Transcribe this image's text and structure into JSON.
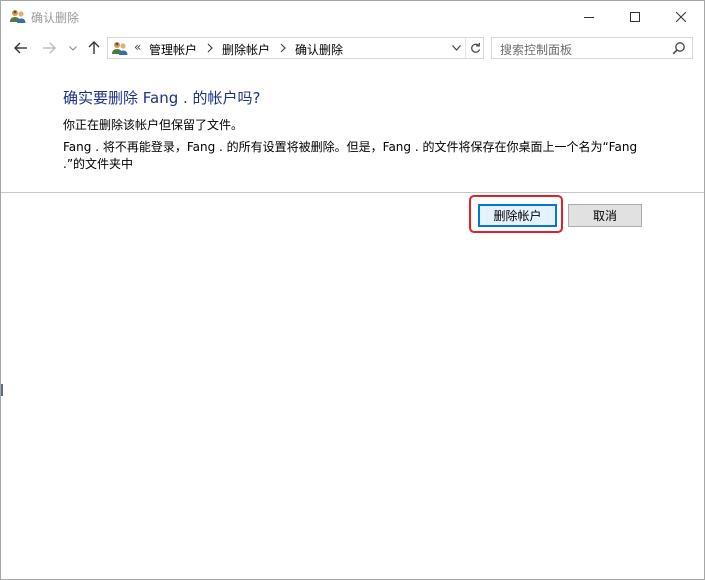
{
  "window": {
    "title": "确认删除"
  },
  "address": {
    "overflow": "«",
    "crumbs": [
      "管理帐户",
      "删除帐户",
      "确认删除"
    ]
  },
  "search": {
    "placeholder": "搜索控制面板"
  },
  "content": {
    "heading": "确实要删除 Fang . 的帐户吗?",
    "line1": "你正在删除该帐户但保留了文件。",
    "line2": "Fang . 将不再能登录，Fang . 的所有设置将被删除。但是，Fang . 的文件将保存在你桌面上一个名为“Fang .”的文件夹中"
  },
  "buttons": {
    "delete": "删除帐户",
    "cancel": "取消"
  },
  "colors": {
    "heading": "#1e3287",
    "highlight": "#e1202e",
    "primary_border": "#0078d7"
  }
}
